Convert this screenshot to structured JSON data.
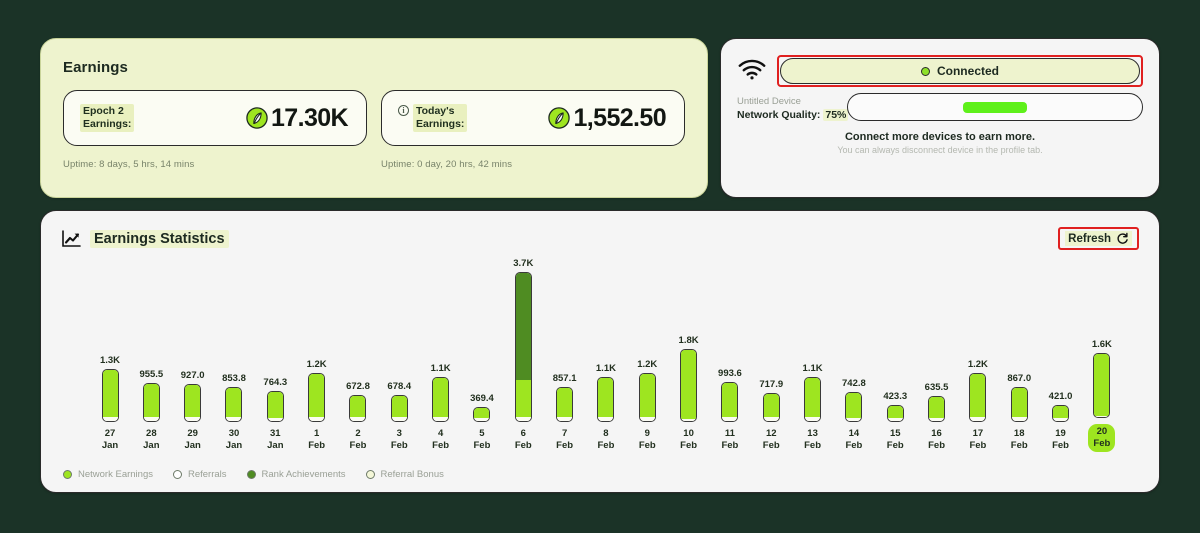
{
  "earnings": {
    "title": "Earnings",
    "stats": [
      {
        "label_line1": "Epoch 2",
        "label_line2": "Earnings:",
        "value": "17.30K",
        "icon": "leaf-icon",
        "has_info_icon": false,
        "uptime": "Uptime: 8 days, 5 hrs, 14 mins"
      },
      {
        "label_line1": "Today's",
        "label_line2": "Earnings:",
        "value": "1,552.50",
        "icon": "leaf-icon",
        "has_info_icon": true,
        "uptime": "Uptime: 0 day, 20 hrs, 42 mins"
      }
    ]
  },
  "device": {
    "wifi_icon": "wifi-icon",
    "status_text": "Connected",
    "status_dot_color": "#8ee02a",
    "highlight_color": "#e02020",
    "device_name": "Untitled Device",
    "network_quality_label": "Network Quality:",
    "network_quality_value": "75%",
    "signal_blob_color": "#5ef01a",
    "footer_primary": "Connect more devices to earn more.",
    "footer_secondary": "You can always disconnect device in the profile tab."
  },
  "stats_panel": {
    "icon": "trending-up-icon",
    "title": "Earnings Statistics",
    "refresh_label": "Refresh",
    "refresh_icon": "refresh-icon"
  },
  "chart_data": {
    "type": "bar",
    "title": "Earnings Statistics",
    "xlabel": "",
    "ylabel": "",
    "stacked": true,
    "grid": false,
    "legend_position": "bottom-left",
    "ylim": [
      0,
      3700
    ],
    "categories": [
      "27 Jan",
      "28 Jan",
      "29 Jan",
      "30 Jan",
      "31 Jan",
      "1 Feb",
      "2 Feb",
      "3 Feb",
      "4 Feb",
      "5 Feb",
      "6 Feb",
      "7 Feb",
      "8 Feb",
      "9 Feb",
      "10 Feb",
      "11 Feb",
      "12 Feb",
      "13 Feb",
      "14 Feb",
      "15 Feb",
      "16 Feb",
      "17 Feb",
      "18 Feb",
      "19 Feb",
      "20 Feb"
    ],
    "day_labels": [
      "27",
      "28",
      "29",
      "30",
      "31",
      "1",
      "2",
      "3",
      "4",
      "5",
      "6",
      "7",
      "8",
      "9",
      "10",
      "11",
      "12",
      "13",
      "14",
      "15",
      "16",
      "17",
      "18",
      "19",
      "20"
    ],
    "month_labels": [
      "Jan",
      "Jan",
      "Jan",
      "Jan",
      "Jan",
      "Feb",
      "Feb",
      "Feb",
      "Feb",
      "Feb",
      "Feb",
      "Feb",
      "Feb",
      "Feb",
      "Feb",
      "Feb",
      "Feb",
      "Feb",
      "Feb",
      "Feb",
      "Feb",
      "Feb",
      "Feb",
      "Feb",
      "Feb"
    ],
    "values": [
      1300,
      955.5,
      927.0,
      853.8,
      764.3,
      1200,
      672.8,
      678.4,
      1100,
      369.4,
      3700,
      857.1,
      1100,
      1200,
      1800,
      993.6,
      717.9,
      1100,
      742.8,
      423.3,
      635.5,
      1200,
      867.0,
      421.0,
      1600
    ],
    "value_labels": [
      "1.3K",
      "955.5",
      "927.0",
      "853.8",
      "764.3",
      "1.2K",
      "672.8",
      "678.4",
      "1.1K",
      "369.4",
      "3.7K",
      "857.1",
      "1.1K",
      "1.2K",
      "1.8K",
      "993.6",
      "717.9",
      "1.1K",
      "742.8",
      "423.3",
      "635.5",
      "1.2K",
      "867.0",
      "421.0",
      "1.6K"
    ],
    "series": [
      {
        "name": "Network Earnings",
        "color": "#9ee520",
        "values": [
          1190,
          855,
          830,
          760,
          680,
          1100,
          580,
          590,
          1010,
          290,
          900,
          760,
          1010,
          1110,
          1740,
          900,
          630,
          1010,
          680,
          340,
          560,
          1100,
          780,
          340,
          1570
        ]
      },
      {
        "name": "Referrals",
        "color": "#ffffff",
        "values": [
          0,
          0,
          0,
          0,
          0,
          0,
          0,
          0,
          0,
          0,
          0,
          0,
          0,
          0,
          0,
          0,
          0,
          0,
          0,
          0,
          0,
          0,
          0,
          0,
          0
        ]
      },
      {
        "name": "Rank Achievements",
        "color": "#4f8c22",
        "values": [
          0,
          0,
          0,
          0,
          0,
          0,
          0,
          0,
          0,
          0,
          2700,
          0,
          0,
          0,
          0,
          0,
          0,
          0,
          0,
          0,
          0,
          0,
          0,
          0,
          0
        ]
      },
      {
        "name": "Referral Bonus",
        "color": "#fbfcf3",
        "values": [
          110,
          100,
          97,
          94,
          84,
          100,
          93,
          88,
          90,
          79,
          100,
          97,
          90,
          90,
          60,
          94,
          88,
          90,
          63,
          83,
          76,
          100,
          87,
          81,
          30
        ]
      }
    ],
    "today_index": 24,
    "legend": [
      {
        "label": "Network Earnings",
        "color": "#9ee520"
      },
      {
        "label": "Referrals",
        "color": "#ffffff"
      },
      {
        "label": "Rank Achievements",
        "color": "#4f8c22"
      },
      {
        "label": "Referral Bonus",
        "color": "#f4f7d8"
      }
    ]
  }
}
